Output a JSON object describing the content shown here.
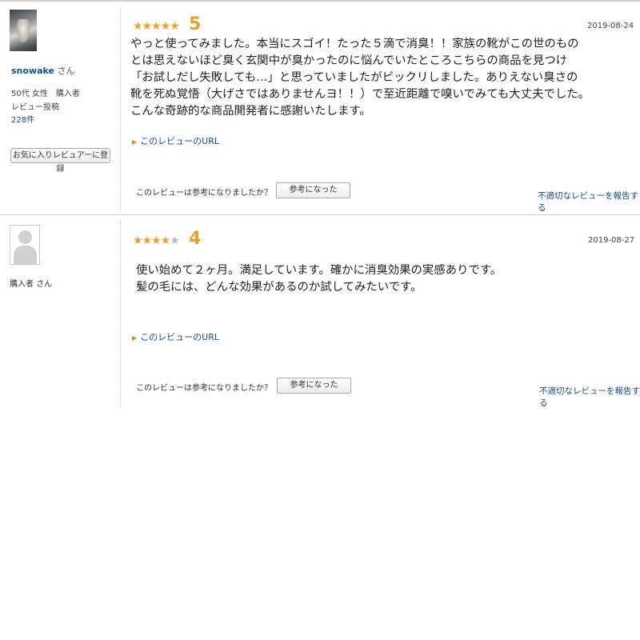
{
  "reviews": [
    {
      "reviewer": {
        "name": "snowake",
        "suffix": "さん",
        "age_gender_type": "50代 女性　購入者",
        "posts_label": "レビュー投稿",
        "posts_count": "228件",
        "favorite_button": "お気に入りレビュアーに登録"
      },
      "rating": 5,
      "stars_filled": "★★★★★",
      "stars_empty": "",
      "score_label": "5",
      "date": "2019-08-24",
      "lines": [
        "やっと使ってみました。本当にスゴイ！たった５滴で消臭！！家族の靴がこの世のもの",
        "とは思えないほど臭く玄関中が臭かったのに悩んでいたところこちらの商品を見つけ",
        "「お試しだし失敗しても…」と思っていましたがビックリしました。ありえない臭さの",
        "靴を死ぬ覚悟（大げさではありませんヨ！！）で至近距離で嗅いでみても大丈夫でした。",
        "こんな奇跡的な商品開発者に感謝いたします。"
      ],
      "url_link": "このレビューのURL",
      "helpful_question": "このレビューは参考になりましたか？",
      "helpful_button": "参考になった",
      "report_link": "不適切なレビューを報告する"
    },
    {
      "reviewer": {
        "name": "購入者",
        "suffix": "さん"
      },
      "rating": 4,
      "stars_filled": "★★★★",
      "stars_empty": "★",
      "score_label": "4",
      "date": "2019-08-27",
      "lines": [
        "使い始めて２ヶ月。満足しています。確かに消臭効果の実感ありです。",
        "髪の毛には、どんな効果があるのか試してみたいです。"
      ],
      "url_link": "このレビューのURL",
      "helpful_question": "このレビューは参考になりましたか？",
      "helpful_button": "参考になった",
      "report_link": "不適切なレビューを報告する"
    }
  ],
  "colors": {
    "star": "#f0a020",
    "star_empty": "#bdbdbd",
    "score": "#e8a02a",
    "link": "#1a4c8c"
  }
}
